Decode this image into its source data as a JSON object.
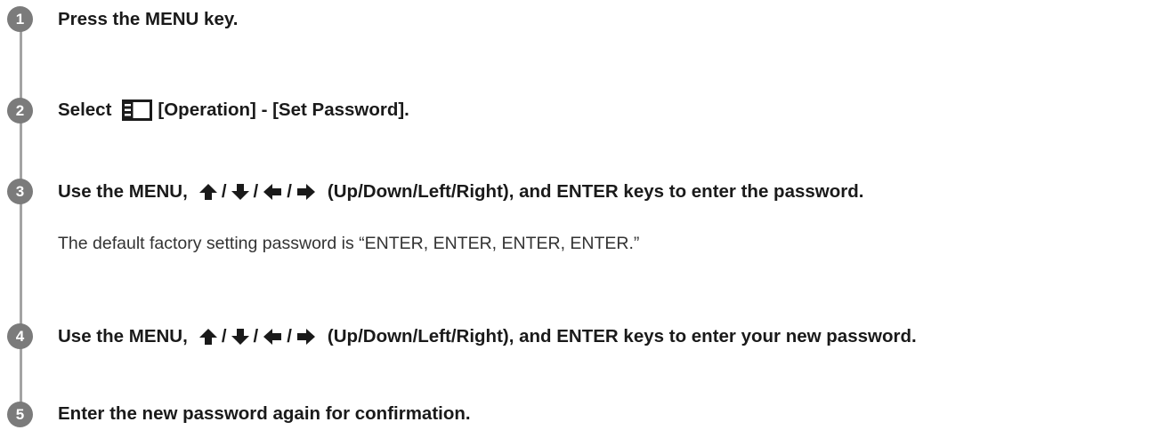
{
  "steps": [
    {
      "number": "1",
      "text": "Press the MENU key."
    },
    {
      "number": "2",
      "prefix": "Select",
      "icon": "operation-menu-icon",
      "suffix": "[Operation] - [Set Password]."
    },
    {
      "number": "3",
      "prefix": "Use the MENU,",
      "arrows": [
        "up-arrow-icon",
        "down-arrow-icon",
        "left-arrow-icon",
        "right-arrow-icon"
      ],
      "separator": "/",
      "suffix": "(Up/Down/Left/Right), and ENTER keys to enter the password.",
      "note": "The default factory setting password is “ENTER, ENTER, ENTER, ENTER.”"
    },
    {
      "number": "4",
      "prefix": "Use the MENU,",
      "arrows": [
        "up-arrow-icon",
        "down-arrow-icon",
        "left-arrow-icon",
        "right-arrow-icon"
      ],
      "separator": "/",
      "suffix": "(Up/Down/Left/Right), and ENTER keys to enter your new password."
    },
    {
      "number": "5",
      "text": "Enter the new password again for confirmation."
    }
  ],
  "colors": {
    "badge": "#7b7b7b",
    "rail": "#a3a3a3",
    "text": "#1a1a1a"
  }
}
